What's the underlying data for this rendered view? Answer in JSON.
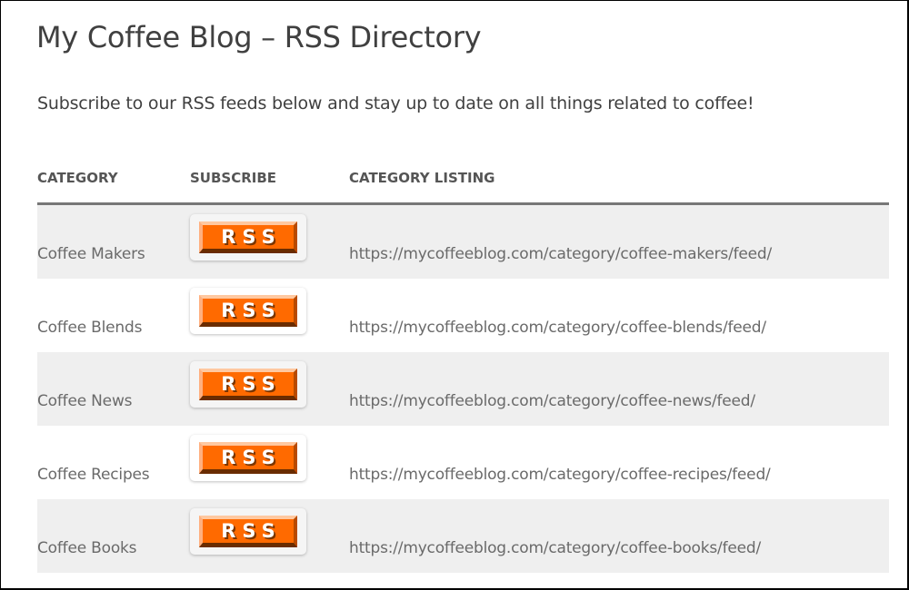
{
  "page": {
    "title": "My Coffee Blog – RSS Directory",
    "intro": "Subscribe to our RSS feeds below and stay up to date on all things related to coffee!"
  },
  "table": {
    "headers": {
      "category": "CATEGORY",
      "subscribe": "SUBSCRIBE",
      "listing": "CATEGORY LISTING"
    },
    "rows": [
      {
        "category": "Coffee Makers",
        "button": "RSS",
        "url": "https://mycoffeeblog.com/category/coffee-makers/feed/"
      },
      {
        "category": "Coffee Blends",
        "button": "RSS",
        "url": "https://mycoffeeblog.com/category/coffee-blends/feed/"
      },
      {
        "category": "Coffee News",
        "button": "RSS",
        "url": "https://mycoffeeblog.com/category/coffee-news/feed/"
      },
      {
        "category": "Coffee Recipes",
        "button": "RSS",
        "url": "https://mycoffeeblog.com/category/coffee-recipes/feed/"
      },
      {
        "category": "Coffee Books",
        "button": "RSS",
        "url": "https://mycoffeeblog.com/category/coffee-books/feed/"
      }
    ]
  },
  "colors": {
    "rss_orange": "#ff6a00",
    "row_alt": "#efefef",
    "header_rule": "#777777"
  }
}
